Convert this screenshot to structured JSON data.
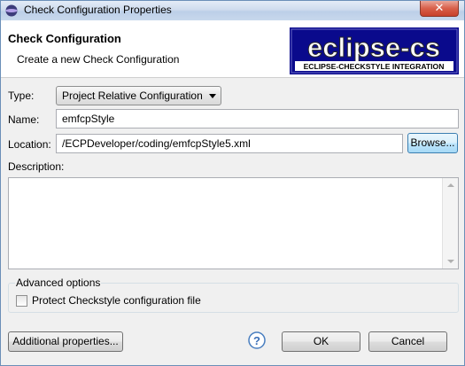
{
  "window": {
    "title": "Check Configuration Properties",
    "close_label": "✕"
  },
  "banner": {
    "heading": "Check Configuration",
    "subtitle": "Create a new Check Configuration",
    "logo_text": "eclipse-cs",
    "logo_tagline": "ECLIPSE-CHECKSTYLE INTEGRATION"
  },
  "form": {
    "type_label": "Type:",
    "type_value": "Project Relative Configuration",
    "name_label": "Name:",
    "name_value": "emfcpStyle",
    "location_label": "Location:",
    "location_value": "/ECPDeveloper/coding/emfcpStyle5.xml",
    "browse_label": "Browse...",
    "description_label": "Description:",
    "description_value": ""
  },
  "advanced": {
    "title": "Advanced options",
    "protect_label": "Protect Checkstyle configuration file",
    "protect_checked": false
  },
  "footer": {
    "additional_label": "Additional properties...",
    "ok_label": "OK",
    "cancel_label": "Cancel",
    "help_glyph": "?"
  },
  "colors": {
    "logo_bg": "#0a0a8c",
    "help_blue": "#3a6fb8"
  }
}
